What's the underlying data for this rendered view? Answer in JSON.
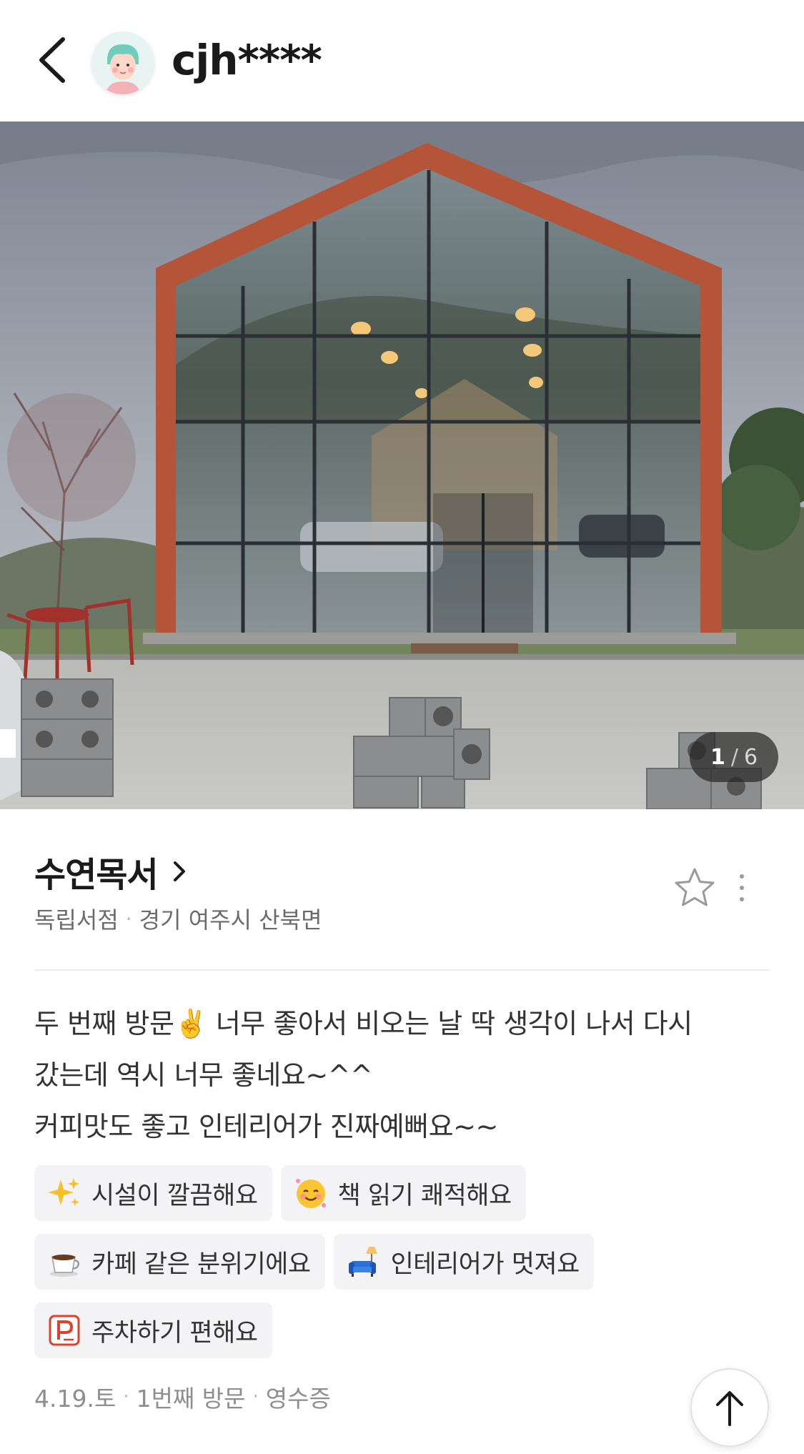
{
  "header": {
    "username": "cjh****",
    "avatar_icon": "user-avatar-icon"
  },
  "photo": {
    "counter_current": "1",
    "counter_total": "6"
  },
  "place": {
    "name": "수연목서",
    "category": "독립서점",
    "location": "경기 여주시 산북면"
  },
  "review": {
    "lines": [
      "두 번째 방문✌️ 너무 좋아서 비오는 날 딱 생각이 나서 다시",
      "갔는데 역시 너무 좋네요~^^",
      "커피맛도 좋고 인테리어가 진짜예뻐요~~"
    ]
  },
  "tags": [
    {
      "icon": "sparkles-icon",
      "label": "시설이 깔끔해요"
    },
    {
      "icon": "smiling-face-icon",
      "label": "책 읽기 쾌적해요"
    },
    {
      "icon": "coffee-cup-icon",
      "label": "카페 같은 분위기에요"
    },
    {
      "icon": "sofa-lamp-icon",
      "label": "인테리어가 멋져요"
    },
    {
      "icon": "parking-icon",
      "label": "주차하기 편해요"
    }
  ],
  "footer": {
    "date": "4.19.토",
    "visit": "1번째 방문",
    "verification": "영수증"
  },
  "colors": {
    "brick": "#b4553a",
    "tag_bg": "#f3f3f5",
    "meta_gray": "#8e8e8e"
  }
}
